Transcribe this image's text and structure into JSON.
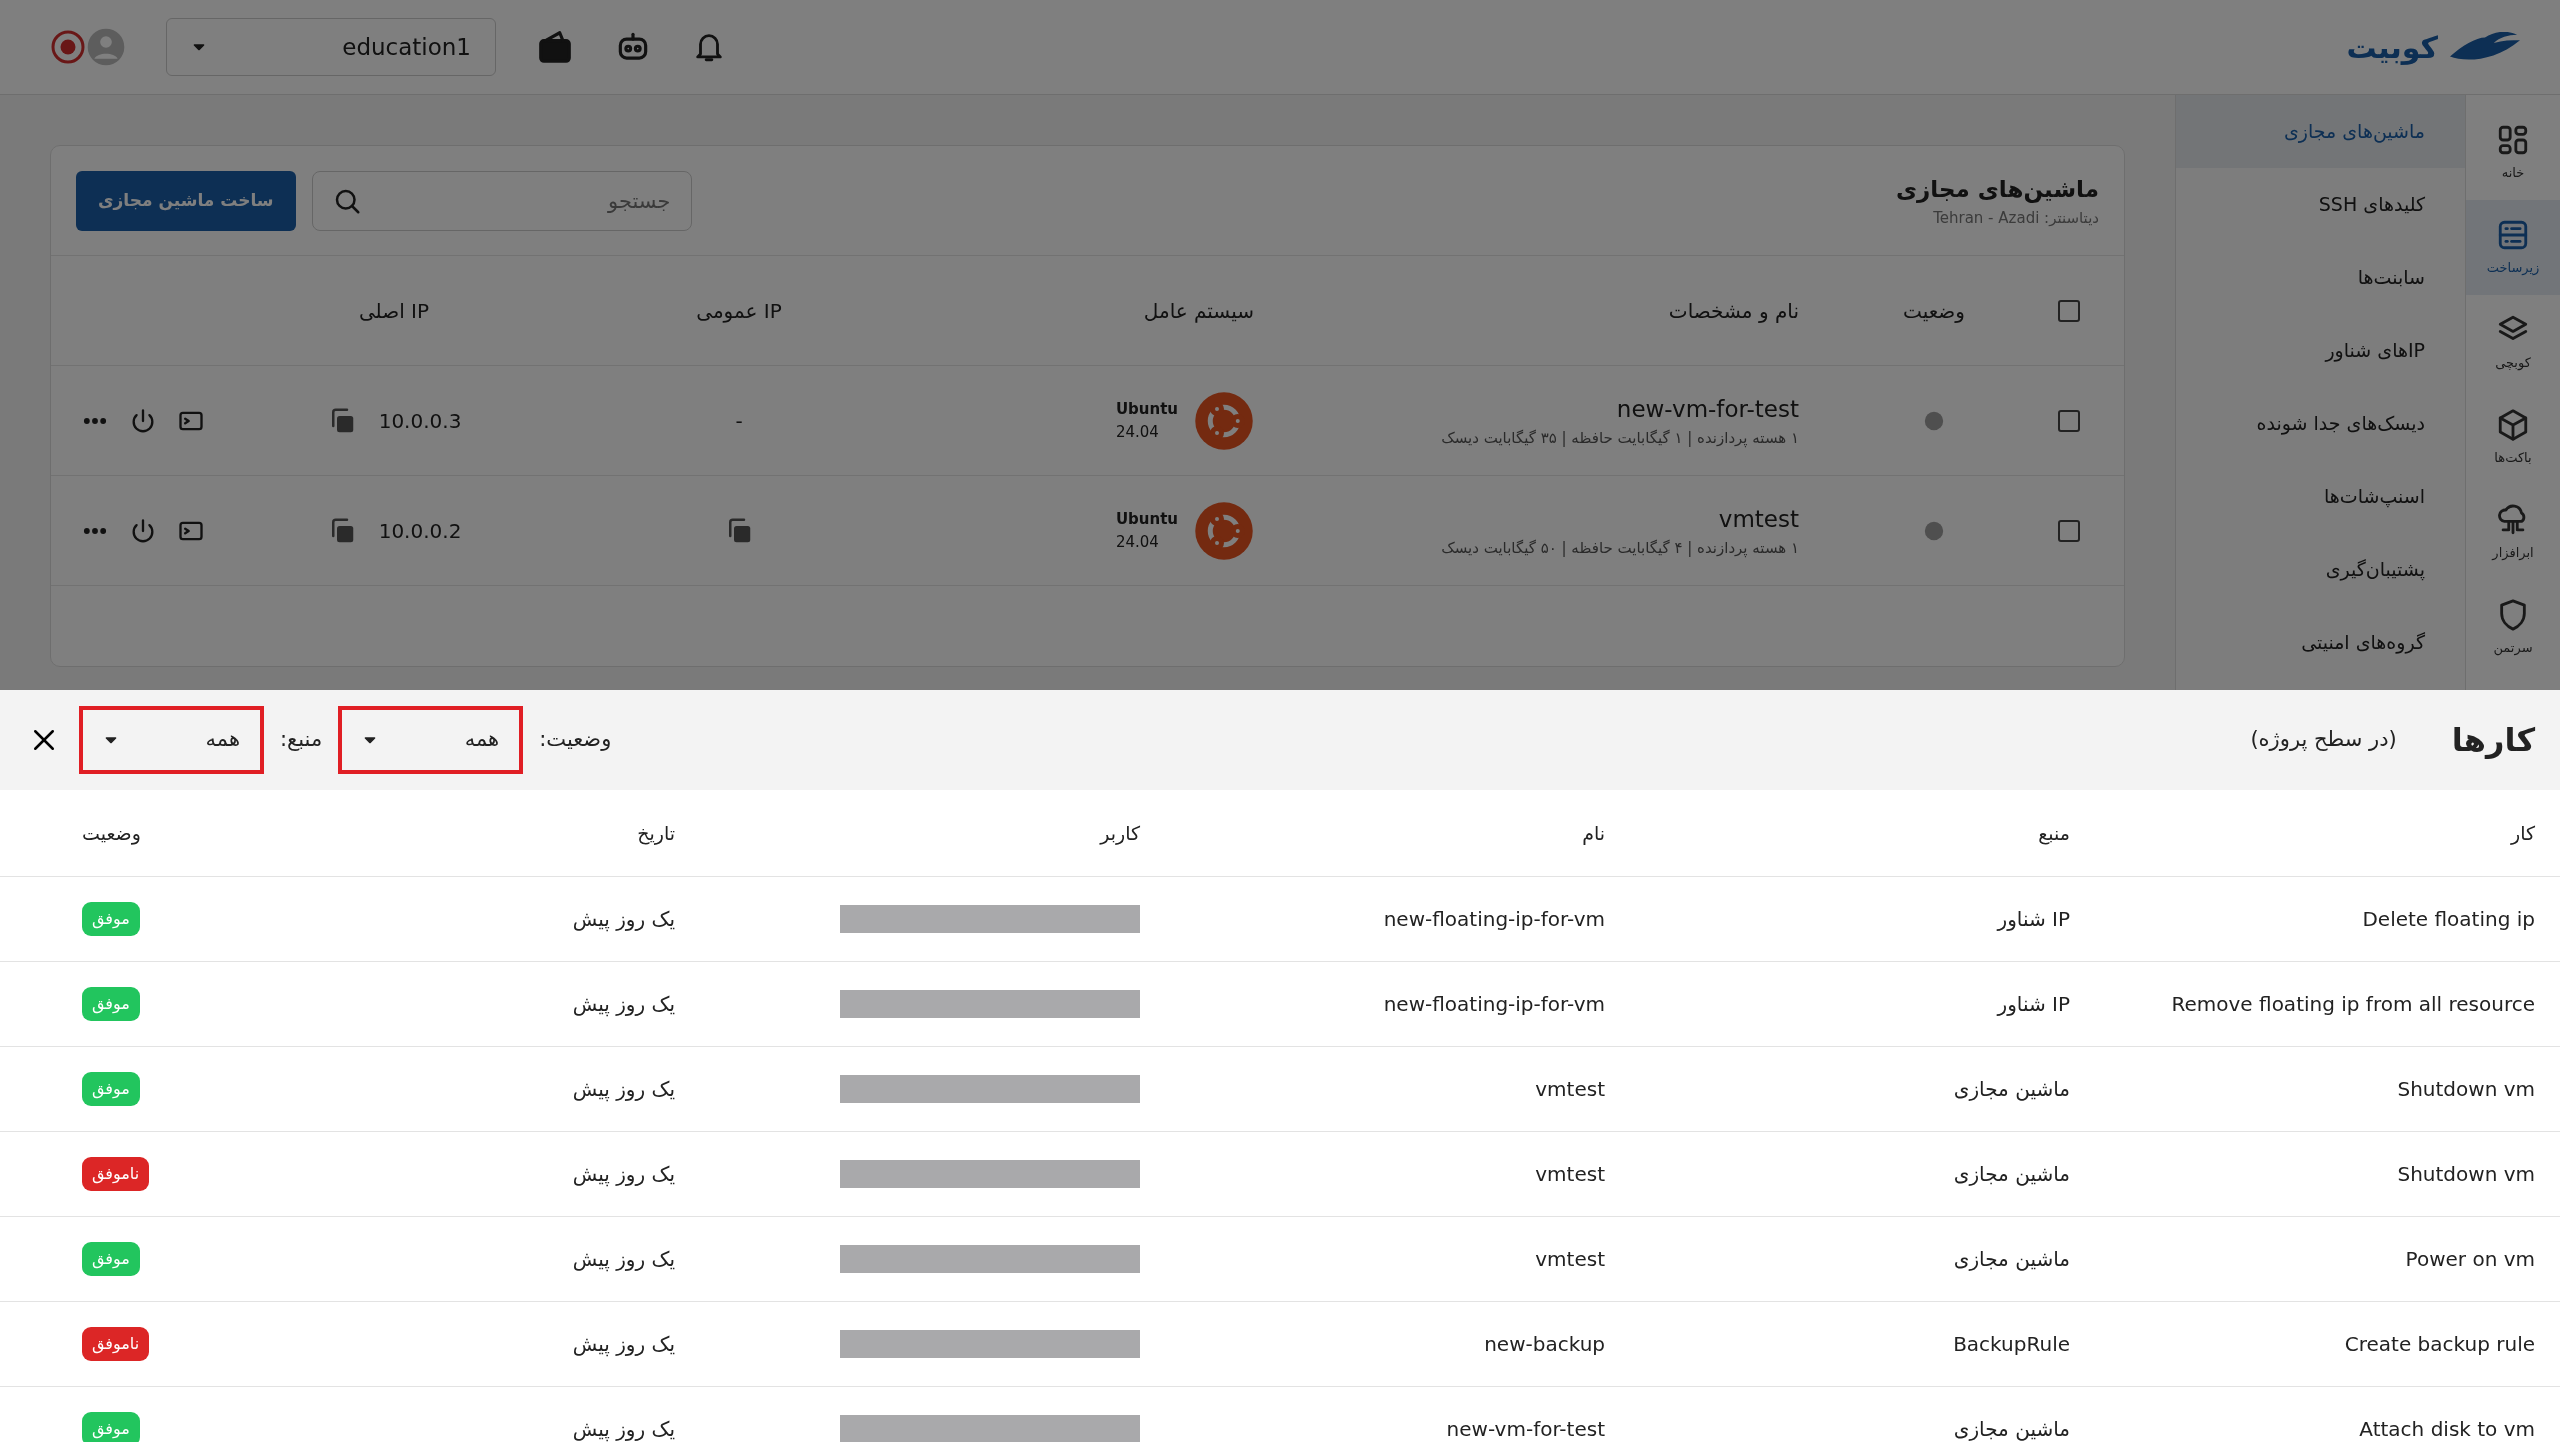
{
  "topbar": {
    "logo_text": "کوبیت",
    "project": "education1"
  },
  "rail": [
    {
      "label": "خانه",
      "selected": false
    },
    {
      "label": "زیرساخت",
      "selected": true
    },
    {
      "label": "کوبچی",
      "selected": false
    },
    {
      "label": "باکت‌ها",
      "selected": false
    },
    {
      "label": "ابرافزار",
      "selected": false
    },
    {
      "label": "سرتمن",
      "selected": false
    }
  ],
  "submenu": [
    {
      "label": "ماشین‌های مجازی",
      "selected": true
    },
    {
      "label": "کلیدهای SSH",
      "selected": false
    },
    {
      "label": "سابنت‌ها",
      "selected": false
    },
    {
      "label": "IPهای شناور",
      "selected": false
    },
    {
      "label": "دیسک‌های جدا شونده",
      "selected": false
    },
    {
      "label": "اسنپ‌شات‌ها",
      "selected": false
    },
    {
      "label": "پشتیبان‌گیری",
      "selected": false
    },
    {
      "label": "گروه‌های امنیتی",
      "selected": false
    }
  ],
  "vm_panel": {
    "title": "ماشین‌های مجازی",
    "datacenter": "دیتاسنتر: Tehran - Azadi",
    "search": {
      "placeholder": "جستجو"
    },
    "create_button": "ساخت ماشین مجازی",
    "select_all_checked": false,
    "columns": [
      "وضعیت",
      "نام و مشخصات",
      "سیستم عامل",
      "IP عمومی",
      "IP اصلی"
    ],
    "rows": [
      {
        "checked": false,
        "name": "new-vm-for-test",
        "specs": "۱ هسته پردازنده | ۱ گیگابایت حافظه | ۳۵ گیگابایت دیسک",
        "os": "Ubuntu",
        "os_version": "24.04",
        "public_ip": "-",
        "private_ip": "10.0.0.3"
      },
      {
        "checked": false,
        "name": "vmtest",
        "specs": "۱ هسته پردازنده | ۴ گیگابایت حافظه | ۵۰ گیگابایت دیسک",
        "os": "Ubuntu",
        "os_version": "24.04",
        "public_ip": "",
        "private_ip": "10.0.0.2"
      }
    ]
  },
  "tasks_panel": {
    "title": "کارها",
    "subtitle": "(در سطح پروژه)",
    "filters": [
      {
        "label": "وضعیت:",
        "value": "همه",
        "highlighted": true
      },
      {
        "label": "منبع:",
        "value": "همه",
        "highlighted": true
      }
    ],
    "columns": [
      "کار",
      "منبع",
      "نام",
      "کاربر",
      "تاریخ",
      "وضعیت"
    ],
    "rows": [
      {
        "task": "Delete floating ip",
        "source": "IP شناور",
        "name": "new-floating-ip-for-vm",
        "date": "یک روز پیش",
        "status": "موفق",
        "kind": "success"
      },
      {
        "task": "Remove floating ip from all resource",
        "source": "IP شناور",
        "name": "new-floating-ip-for-vm",
        "date": "یک روز پیش",
        "status": "موفق",
        "kind": "success"
      },
      {
        "task": "Shutdown vm",
        "source": "ماشین مجازی",
        "name": "vmtest",
        "date": "یک روز پیش",
        "status": "موفق",
        "kind": "success"
      },
      {
        "task": "Shutdown vm",
        "source": "ماشین مجازی",
        "name": "vmtest",
        "date": "یک روز پیش",
        "status": "ناموفق",
        "kind": "failed"
      },
      {
        "task": "Power on vm",
        "source": "ماشین مجازی",
        "name": "vmtest",
        "date": "یک روز پیش",
        "status": "موفق",
        "kind": "success"
      },
      {
        "task": "Create backup rule",
        "source": "BackupRule",
        "name": "new-backup",
        "date": "یک روز پیش",
        "status": "ناموفق",
        "kind": "failed"
      },
      {
        "task": "Attach disk to vm",
        "source": "ماشین مجازی",
        "name": "new-vm-for-test",
        "date": "یک روز پیش",
        "status": "موفق",
        "kind": "success"
      }
    ]
  }
}
